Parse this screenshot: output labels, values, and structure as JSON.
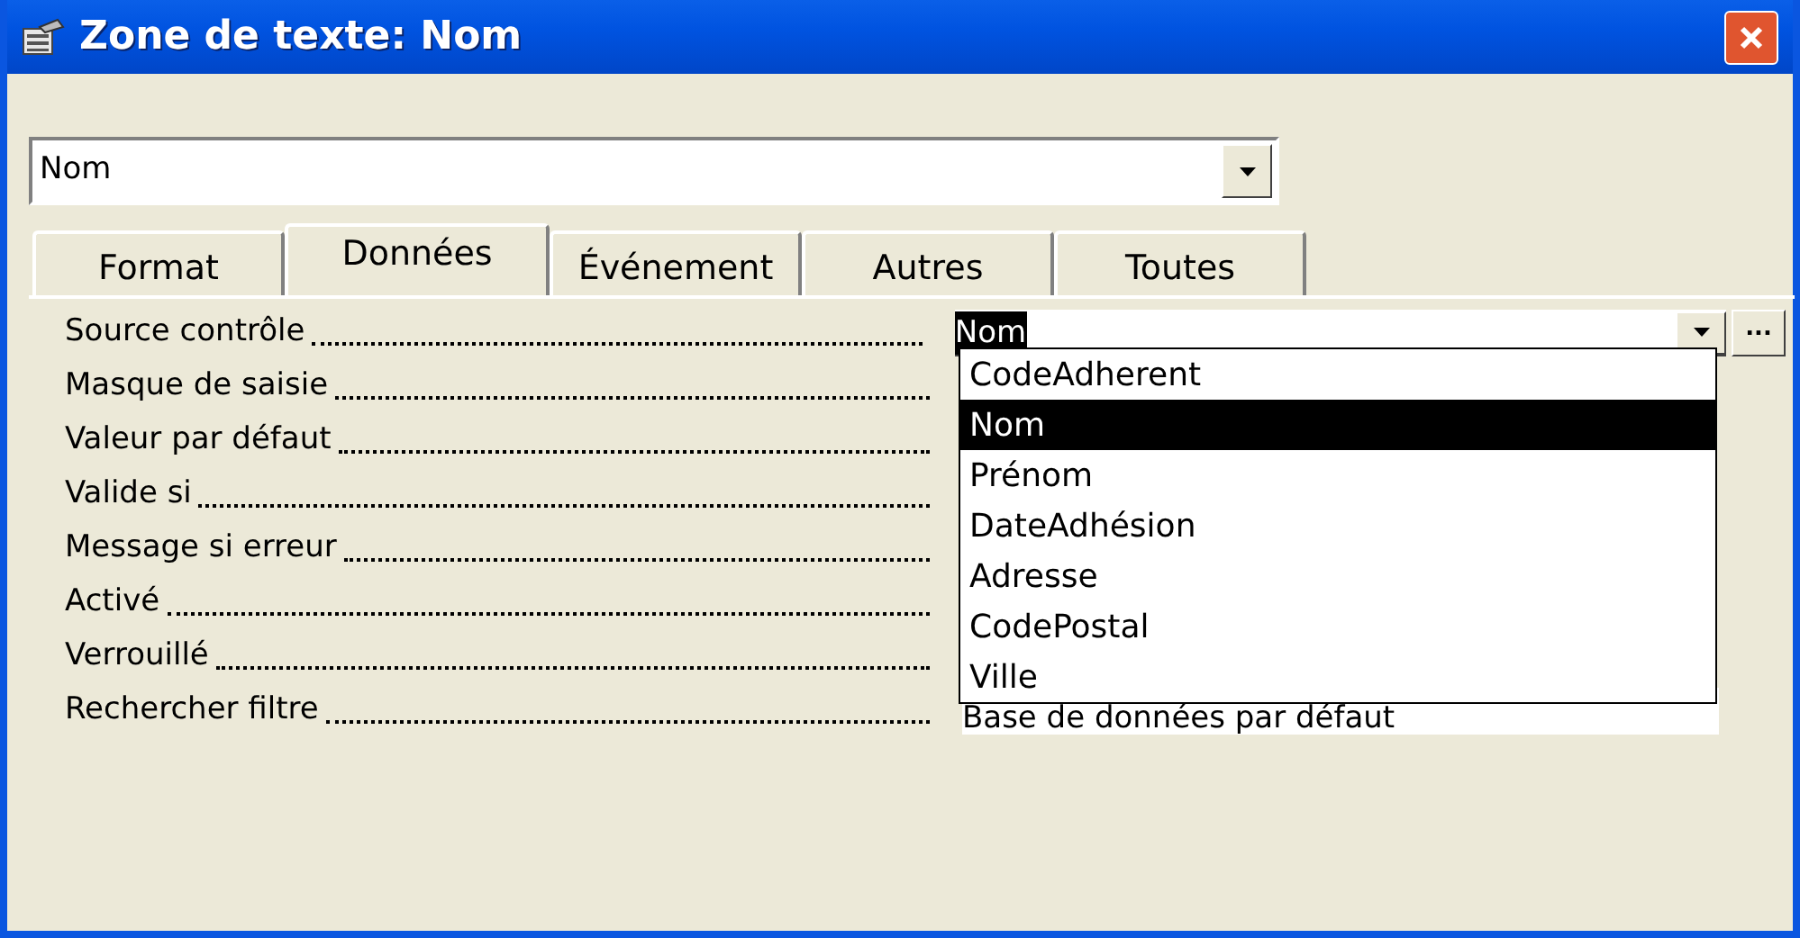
{
  "window": {
    "title": "Zone de texte: Nom"
  },
  "object_selector": {
    "value": "Nom"
  },
  "tabs": [
    {
      "label": "Format",
      "selected": false
    },
    {
      "label": "Données",
      "selected": true
    },
    {
      "label": "Événement",
      "selected": false
    },
    {
      "label": "Autres",
      "selected": false
    },
    {
      "label": "Toutes",
      "selected": false
    }
  ],
  "properties": [
    {
      "label": "Source contrôle",
      "value": "Nom",
      "kind": "combo"
    },
    {
      "label": "Masque de saisie"
    },
    {
      "label": "Valeur par défaut"
    },
    {
      "label": "Valide si"
    },
    {
      "label": "Message si erreur"
    },
    {
      "label": "Activé"
    },
    {
      "label": "Verrouillé"
    },
    {
      "label": "Rechercher filtre",
      "value": "Base de données par défaut",
      "kind": "text"
    }
  ],
  "dropdown_list": [
    {
      "label": "CodeAdherent",
      "selected": false
    },
    {
      "label": "Nom",
      "selected": true
    },
    {
      "label": "Prénom",
      "selected": false
    },
    {
      "label": "DateAdhésion",
      "selected": false
    },
    {
      "label": "Adresse",
      "selected": false
    },
    {
      "label": "CodePostal",
      "selected": false
    },
    {
      "label": "Ville",
      "selected": false
    }
  ],
  "builder_button": {
    "label": "..."
  }
}
